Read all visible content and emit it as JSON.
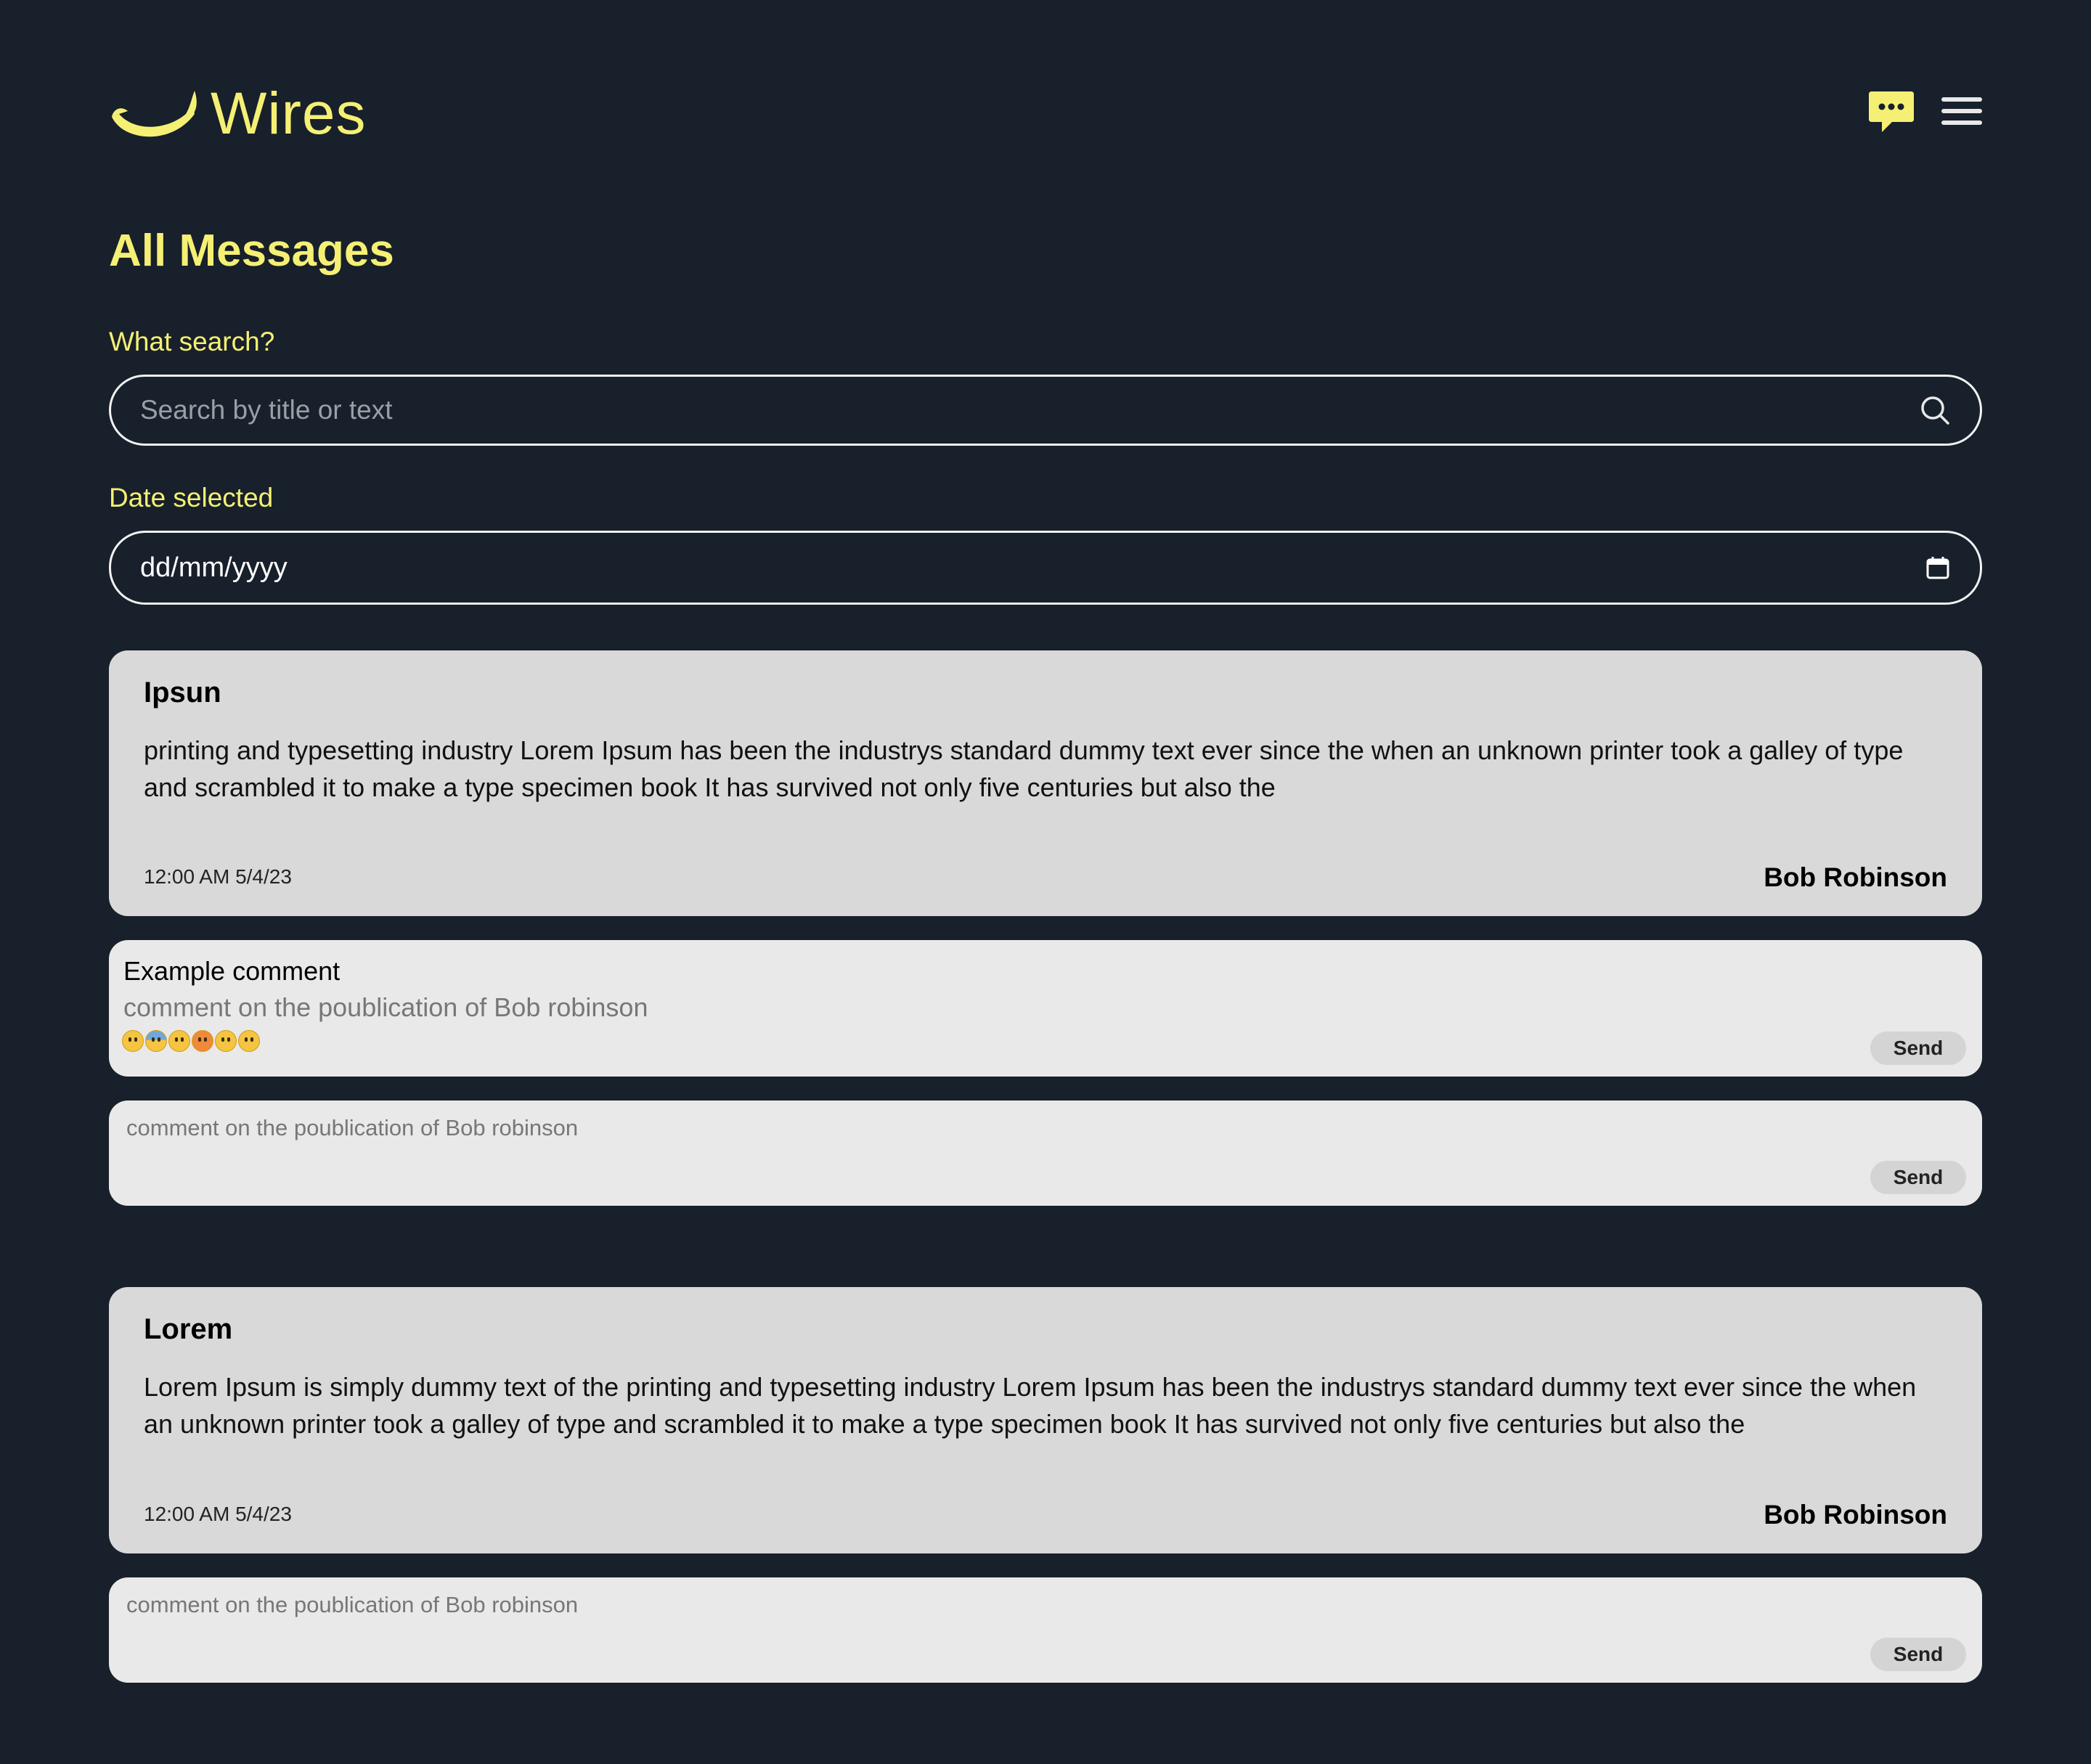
{
  "app": {
    "name": "Wires",
    "accent": "#f5f074",
    "background": "#18202b",
    "logo_icon": "smile-arc-logo",
    "chat_icon": "chat-bubble-icon",
    "menu_icon": "hamburger-menu-icon"
  },
  "page": {
    "title": "All Messages"
  },
  "search": {
    "label": "What search?",
    "placeholder": "Search by title or text",
    "icon": "search-icon"
  },
  "date": {
    "label": "Date selected",
    "value": "dd/mm/yyyy",
    "icon": "calendar-icon"
  },
  "posts": [
    {
      "title": "Ipsun",
      "text": "printing and typesetting industry Lorem Ipsum has been the industrys standard dummy text ever since the when an unknown printer took a galley of type and scrambled it to make a type specimen book It has survived not only five centuries but also the",
      "time": "12:00 AM 5/4/23",
      "author": "Bob Robinson",
      "comments": [
        {
          "author": "Example comment",
          "text": "comment on the poublication of Bob robinson",
          "reactions": [
            "grinning-face",
            "anxious-face",
            "confused-face",
            "angry-face",
            "hushed-face",
            "hushed-face"
          ],
          "send_label": "Send"
        }
      ],
      "new_comment": {
        "placeholder": "comment on the poublication of Bob robinson",
        "send_label": "Send"
      }
    },
    {
      "title": "Lorem",
      "text": "Lorem Ipsum is simply dummy text of the printing and typesetting industry Lorem Ipsum has been the industrys standard dummy text ever since the when an unknown printer took a galley of type and scrambled it to make a type specimen book It has survived not only five centuries but also the",
      "time": "12:00 AM 5/4/23",
      "author": "Bob Robinson",
      "comments": [],
      "new_comment": {
        "placeholder": "comment on the poublication of Bob robinson",
        "send_label": "Send"
      }
    }
  ]
}
